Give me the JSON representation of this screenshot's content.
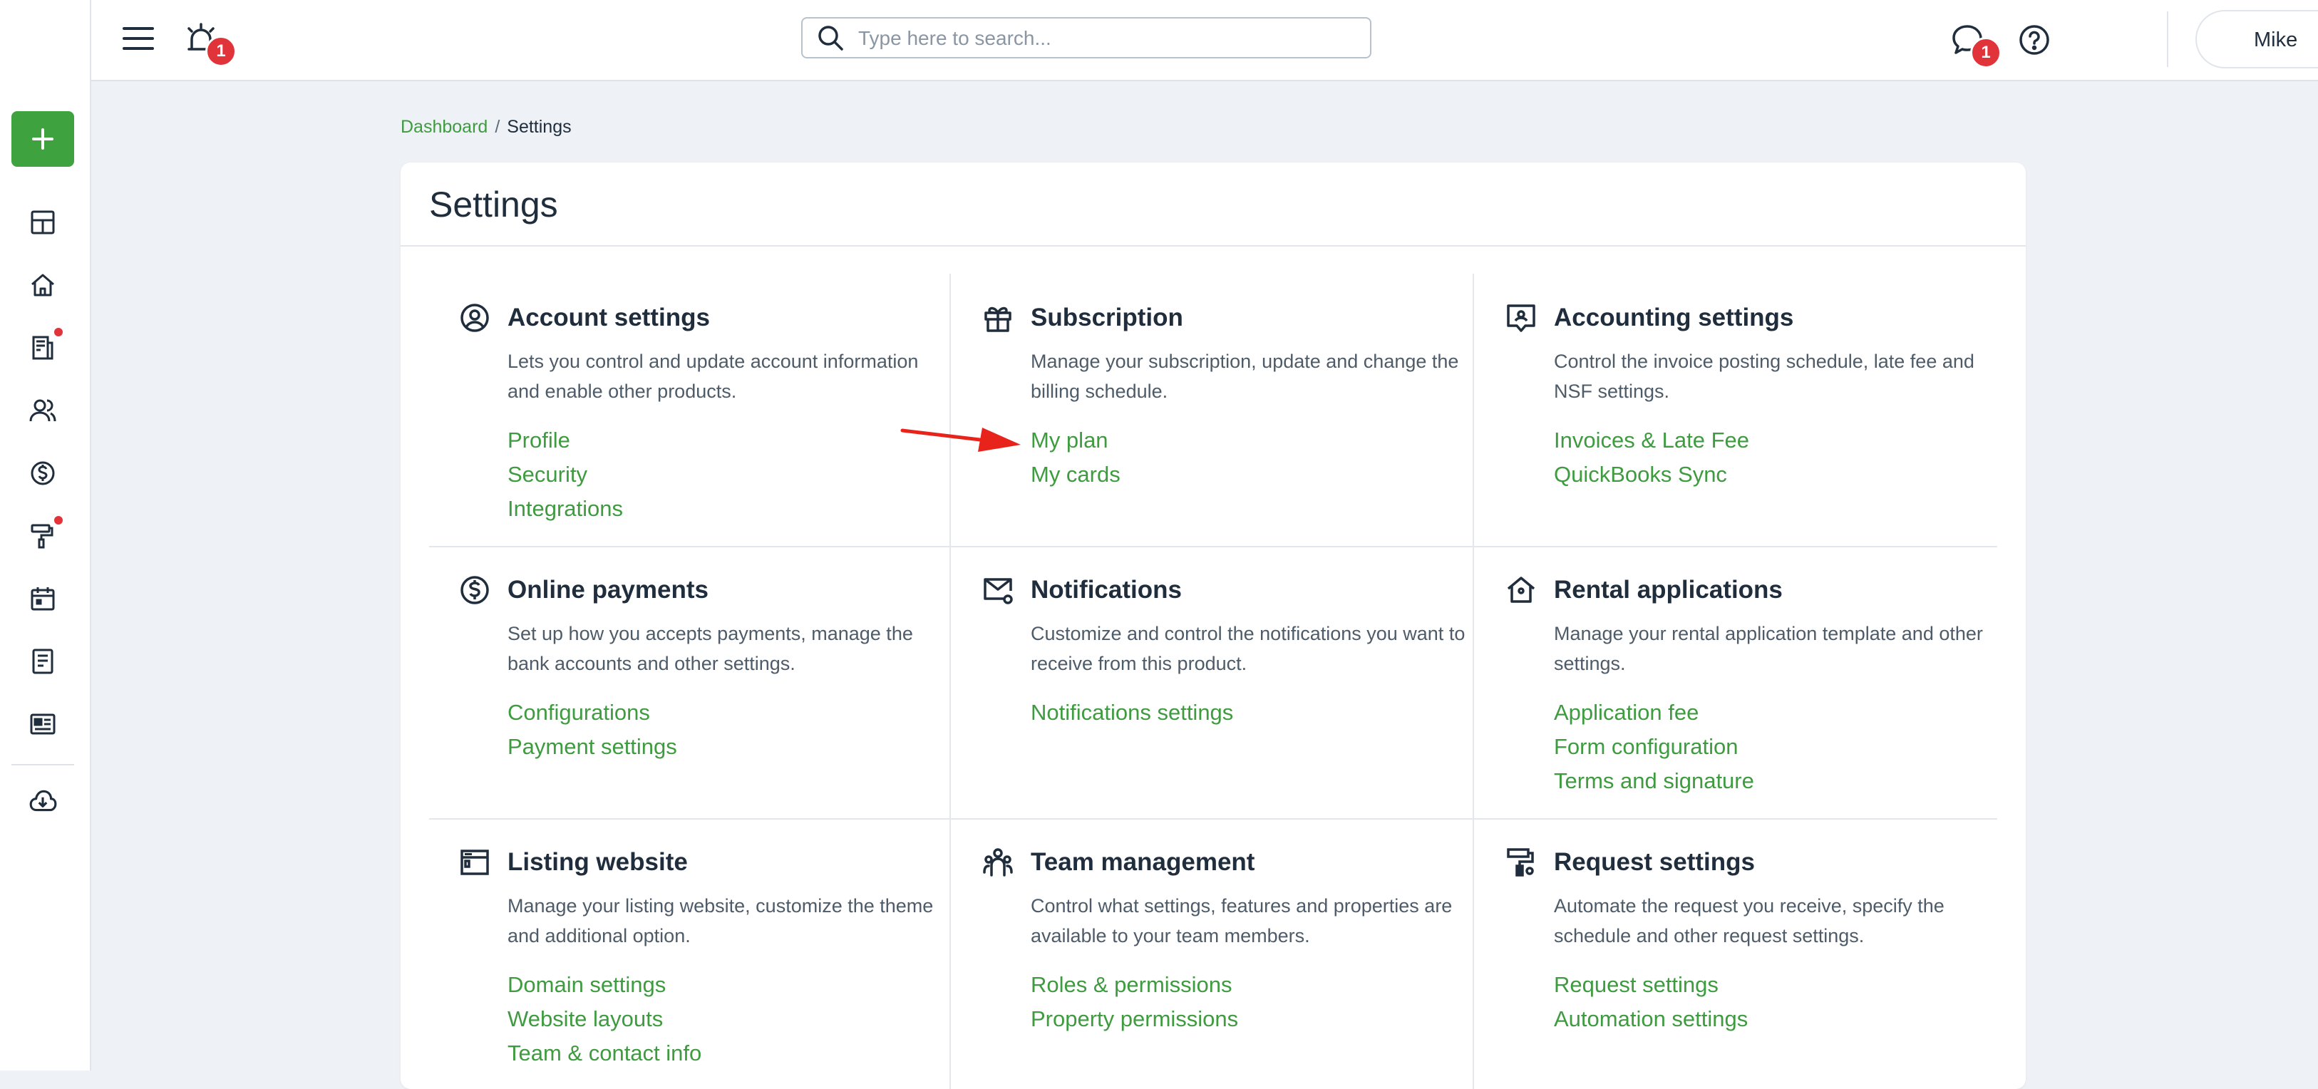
{
  "header": {
    "alerts_badge": "1",
    "messages_badge": "1",
    "search_placeholder": "Type here to search...",
    "user_name": "Mike"
  },
  "sidebar": {
    "items": [
      "create-icon",
      "dashboard-icon",
      "home-icon",
      "document-icon",
      "people-icon",
      "dollar-icon",
      "paint-roller-icon",
      "calendar-icon",
      "notes-icon",
      "id-card-icon",
      "cloud-download-icon"
    ]
  },
  "breadcrumb": {
    "root": "Dashboard",
    "separator": "/",
    "current": "Settings"
  },
  "page": {
    "title": "Settings"
  },
  "accent_color": "#3e9b3f",
  "sections": [
    {
      "title": "Account settings",
      "description": "Lets you control and update account information and enable other products.",
      "links": [
        "Profile",
        "Security",
        "Integrations"
      ]
    },
    {
      "title": "Subscription",
      "description": "Manage your subscription, update and change the billing schedule.",
      "links": [
        "My plan",
        "My cards"
      ]
    },
    {
      "title": "Accounting settings",
      "description": "Control the invoice posting schedule, late fee and NSF settings.",
      "links": [
        "Invoices & Late Fee",
        "QuickBooks Sync"
      ]
    },
    {
      "title": "Online payments",
      "description": "Set up how you accepts payments, manage the bank accounts and other settings.",
      "links": [
        "Configurations",
        "Payment settings"
      ]
    },
    {
      "title": "Notifications",
      "description": "Customize and control the notifications you want to receive from this product.",
      "links": [
        "Notifications settings"
      ]
    },
    {
      "title": "Rental applications",
      "description": "Manage your rental application template and other settings.",
      "links": [
        "Application fee",
        "Form configuration",
        "Terms and signature"
      ]
    },
    {
      "title": "Listing website",
      "description": "Manage your listing website, customize the theme and additional option.",
      "links": [
        "Domain settings",
        "Website layouts",
        "Team & contact info"
      ]
    },
    {
      "title": "Team management",
      "description": "Control what settings, features and properties are available to your team members.",
      "links": [
        "Roles & permissions",
        "Property permissions"
      ]
    },
    {
      "title": "Request settings",
      "description": "Automate the request you receive, specify the schedule and other request settings.",
      "links": [
        "Request settings",
        "Automation settings"
      ]
    }
  ]
}
